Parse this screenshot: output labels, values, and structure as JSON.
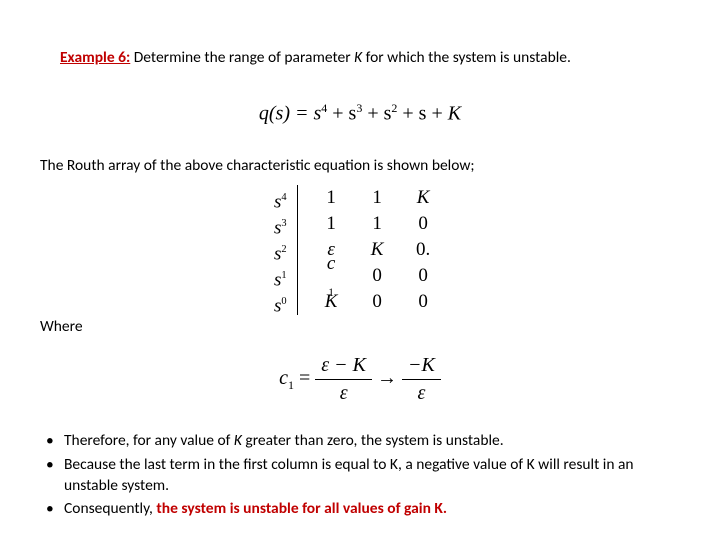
{
  "title": {
    "example_label": "Example 6:",
    "rest_a": " Determine the range of parameter ",
    "K": "K",
    "rest_b": " for which the system is unstable."
  },
  "eq1": {
    "qs": "q(s) = s",
    "p4": "4",
    "plus_s": " + s",
    "p3": "3",
    "p2": "2",
    "plus_s_end": " + s + ",
    "K": "K"
  },
  "p2": "The Routh array of the above characteristic equation is shown below;",
  "routh": {
    "s_labels": [
      "s⁴",
      "s³",
      "s²",
      "s¹",
      "s⁰"
    ],
    "cells": [
      [
        "1",
        "1",
        "K"
      ],
      [
        "1",
        "1",
        "0"
      ],
      [
        "ε",
        "K",
        "0."
      ],
      [
        "c₁",
        "0",
        "0"
      ],
      [
        "K",
        "0",
        "0"
      ]
    ]
  },
  "where": "Where",
  "eq2": {
    "lhs": "c",
    "lhs_sub": "1",
    "eq": " = ",
    "num1": "ε − K",
    "den1": "ε",
    "arrow": " → ",
    "num2": "−K",
    "den2": "ε"
  },
  "bullets": {
    "b1a": "Therefore, for any value of ",
    "b1K": "K",
    "b1b": " greater than zero, the system is unstable.",
    "b2": "Because the last term in the first column is equal to K, a negative value of K will result in an unstable system.",
    "b3a": "Consequently, ",
    "b3b": "the system is unstable for all values of gain K."
  }
}
